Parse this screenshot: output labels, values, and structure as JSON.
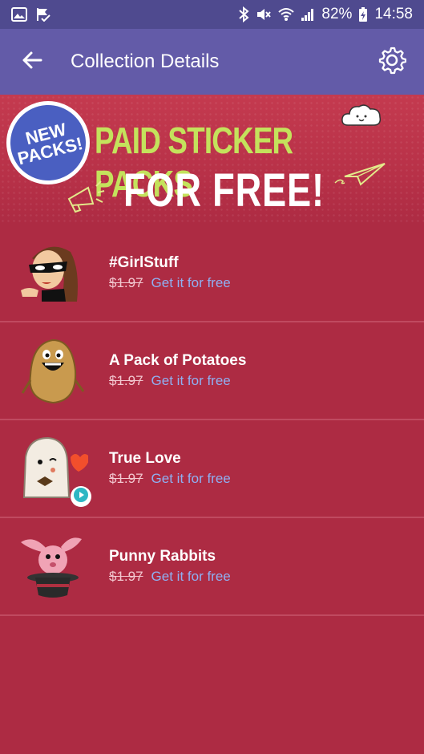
{
  "status_bar": {
    "battery": "82%",
    "time": "14:58"
  },
  "app_bar": {
    "title": "Collection Details"
  },
  "banner": {
    "badge_line1": "NEW",
    "badge_line2": "PACKS!",
    "headline1": "PAID STICKER PACKS",
    "headline2": "FOR FREE!"
  },
  "packs": [
    {
      "name": "#GirlStuff",
      "old_price": "$1.97",
      "action": "Get it for free"
    },
    {
      "name": "A Pack of Potatoes",
      "old_price": "$1.97",
      "action": "Get it for free"
    },
    {
      "name": "True Love",
      "old_price": "$1.97",
      "action": "Get it for free"
    },
    {
      "name": "Punny Rabbits",
      "old_price": "$1.97",
      "action": "Get it for free"
    }
  ],
  "colors": {
    "status_bar": "#4f4a8f",
    "app_bar": "#635ba8",
    "background": "#ad2b43",
    "link": "#8fb0f2"
  }
}
